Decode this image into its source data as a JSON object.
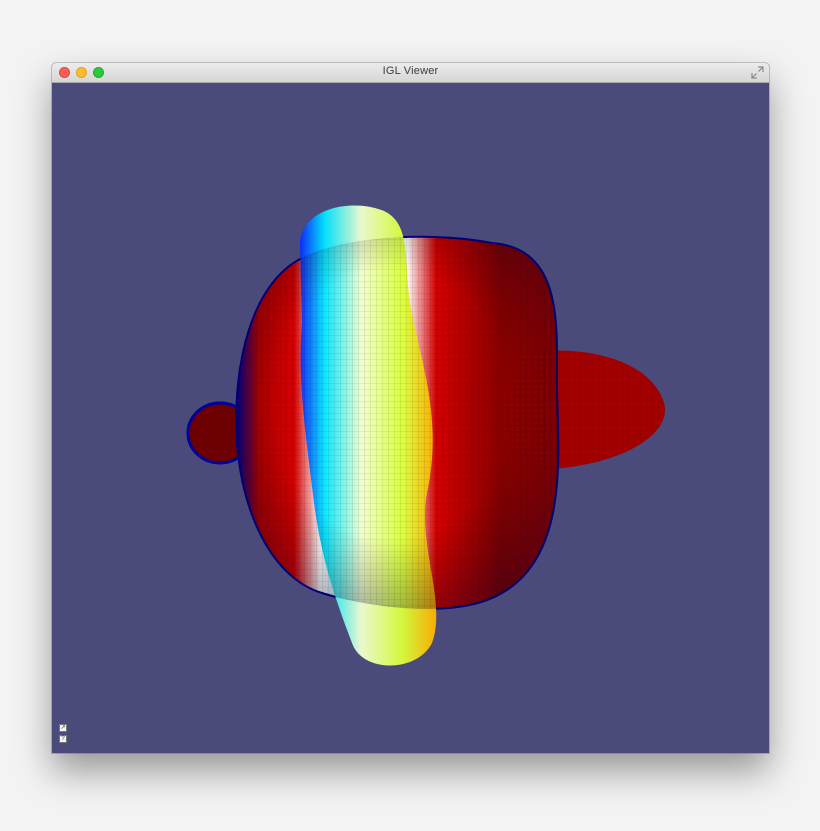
{
  "window": {
    "title": "IGL Viewer",
    "background": "#4a4a7b"
  },
  "viewport": {
    "mesh_colormap": [
      "#0000a8",
      "#00e5ff",
      "#ffffff",
      "#c6ff00",
      "#ff2a00",
      "#9a0000"
    ]
  },
  "overlay_buttons": [
    {
      "name": "view-toggle-icon",
      "glyph": "↗"
    },
    {
      "name": "help-toggle-icon",
      "glyph": "?"
    }
  ]
}
